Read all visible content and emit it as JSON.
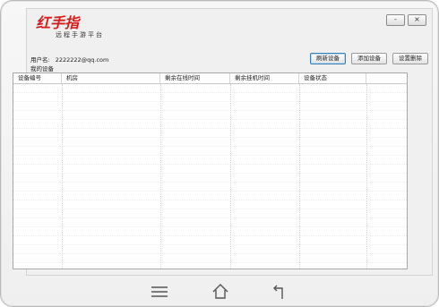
{
  "window": {
    "brand_main": "红手指",
    "tagline": "远程手游平台",
    "minimize_label": "-",
    "close_label": "×"
  },
  "user": {
    "label": "用户名:",
    "email": "2222222@qq.com"
  },
  "device_list": {
    "label": "我的设备",
    "buttons": {
      "refresh": "刷新设备",
      "add": "添加设备",
      "settings": "设置删除"
    },
    "columns": [
      "设备编号",
      "机房",
      "剩余在线时间",
      "剩余挂机时间",
      "设备状态"
    ],
    "rows": []
  },
  "navigation": {
    "menu_icon": "menu-icon",
    "home_icon": "home-icon",
    "back_icon": "back-icon"
  }
}
